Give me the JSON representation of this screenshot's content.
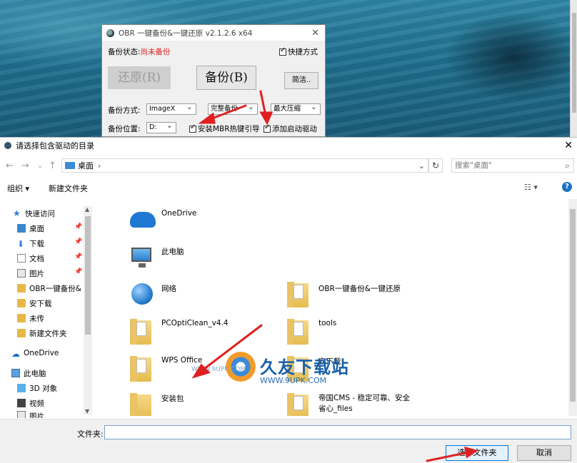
{
  "obr": {
    "title": "OBR 一键备份&一键还原 v2.1.2.6 x64",
    "status_label": "备份状态:",
    "status_value": "尚未备份",
    "status_color": "#e02020",
    "shortcut_label": "快捷方式",
    "restore_label": "还原(R)",
    "backup_label": "备份(B)",
    "clean_label": "简洁..",
    "mode_label": "备份方式:",
    "mode_value": "ImageX",
    "type_value": "完整备份",
    "compress_value": "最大压缩",
    "location_label": "备份位置:",
    "location_value": "D:",
    "mbr_label": "安装MBR热键引导",
    "boot_label": "添加启动驱动"
  },
  "dialog": {
    "title": "请选择包含驱动的目录",
    "address": "桌面",
    "search_placeholder": "搜索\"桌面\"",
    "organize": "组织 ▾",
    "new_folder": "新建文件夹",
    "filename_label": "文件夹:",
    "filename_value": "",
    "select_button": "选择文件夹",
    "cancel_button": "取消"
  },
  "sidebar": {
    "items": [
      {
        "label": "快速访问",
        "icon": "star-icon"
      },
      {
        "label": "桌面",
        "icon": "desktop-icon"
      },
      {
        "label": "下载",
        "icon": "download-icon"
      },
      {
        "label": "文档",
        "icon": "document-icon"
      },
      {
        "label": "图片",
        "icon": "picture-icon"
      },
      {
        "label": "OBR一键备份&",
        "icon": "folder-icon"
      },
      {
        "label": "安下载",
        "icon": "folder-icon"
      },
      {
        "label": "未传",
        "icon": "folder-icon"
      },
      {
        "label": "新建文件夹",
        "icon": "folder-icon"
      },
      {
        "label": "OneDrive",
        "icon": "cloud-icon"
      },
      {
        "label": "此电脑",
        "icon": "pc-icon"
      },
      {
        "label": "3D 对象",
        "icon": "3d-icon"
      },
      {
        "label": "视频",
        "icon": "video-icon"
      },
      {
        "label": "图片",
        "icon": "picture-icon"
      }
    ]
  },
  "content": {
    "items": [
      {
        "label": "OneDrive",
        "icon": "onedrive-icon"
      },
      {
        "label": "此电脑",
        "icon": "pc-icon"
      },
      {
        "label": "网络",
        "icon": "network-icon"
      },
      {
        "label": "OBR一键备份&一键还原",
        "icon": "folder-icon"
      },
      {
        "label": "PCOptiClean_v4.4",
        "icon": "folder-icon"
      },
      {
        "label": "tools",
        "icon": "folder-icon"
      },
      {
        "label": "WPS Office",
        "icon": "folder-icon"
      },
      {
        "label": "安下载",
        "icon": "folder-icon"
      },
      {
        "label": "安装包",
        "icon": "folder-icon"
      },
      {
        "label": "帝国CMS - 稳定可靠、安全省心_files",
        "icon": "folder-icon"
      }
    ]
  },
  "watermark": {
    "brand": "久友下载站",
    "url": "WWW.9UPK.COM",
    "small": "WWW.9UPK.COM"
  },
  "colors": {
    "arrow": "#e02020",
    "accent": "#0078d7"
  }
}
